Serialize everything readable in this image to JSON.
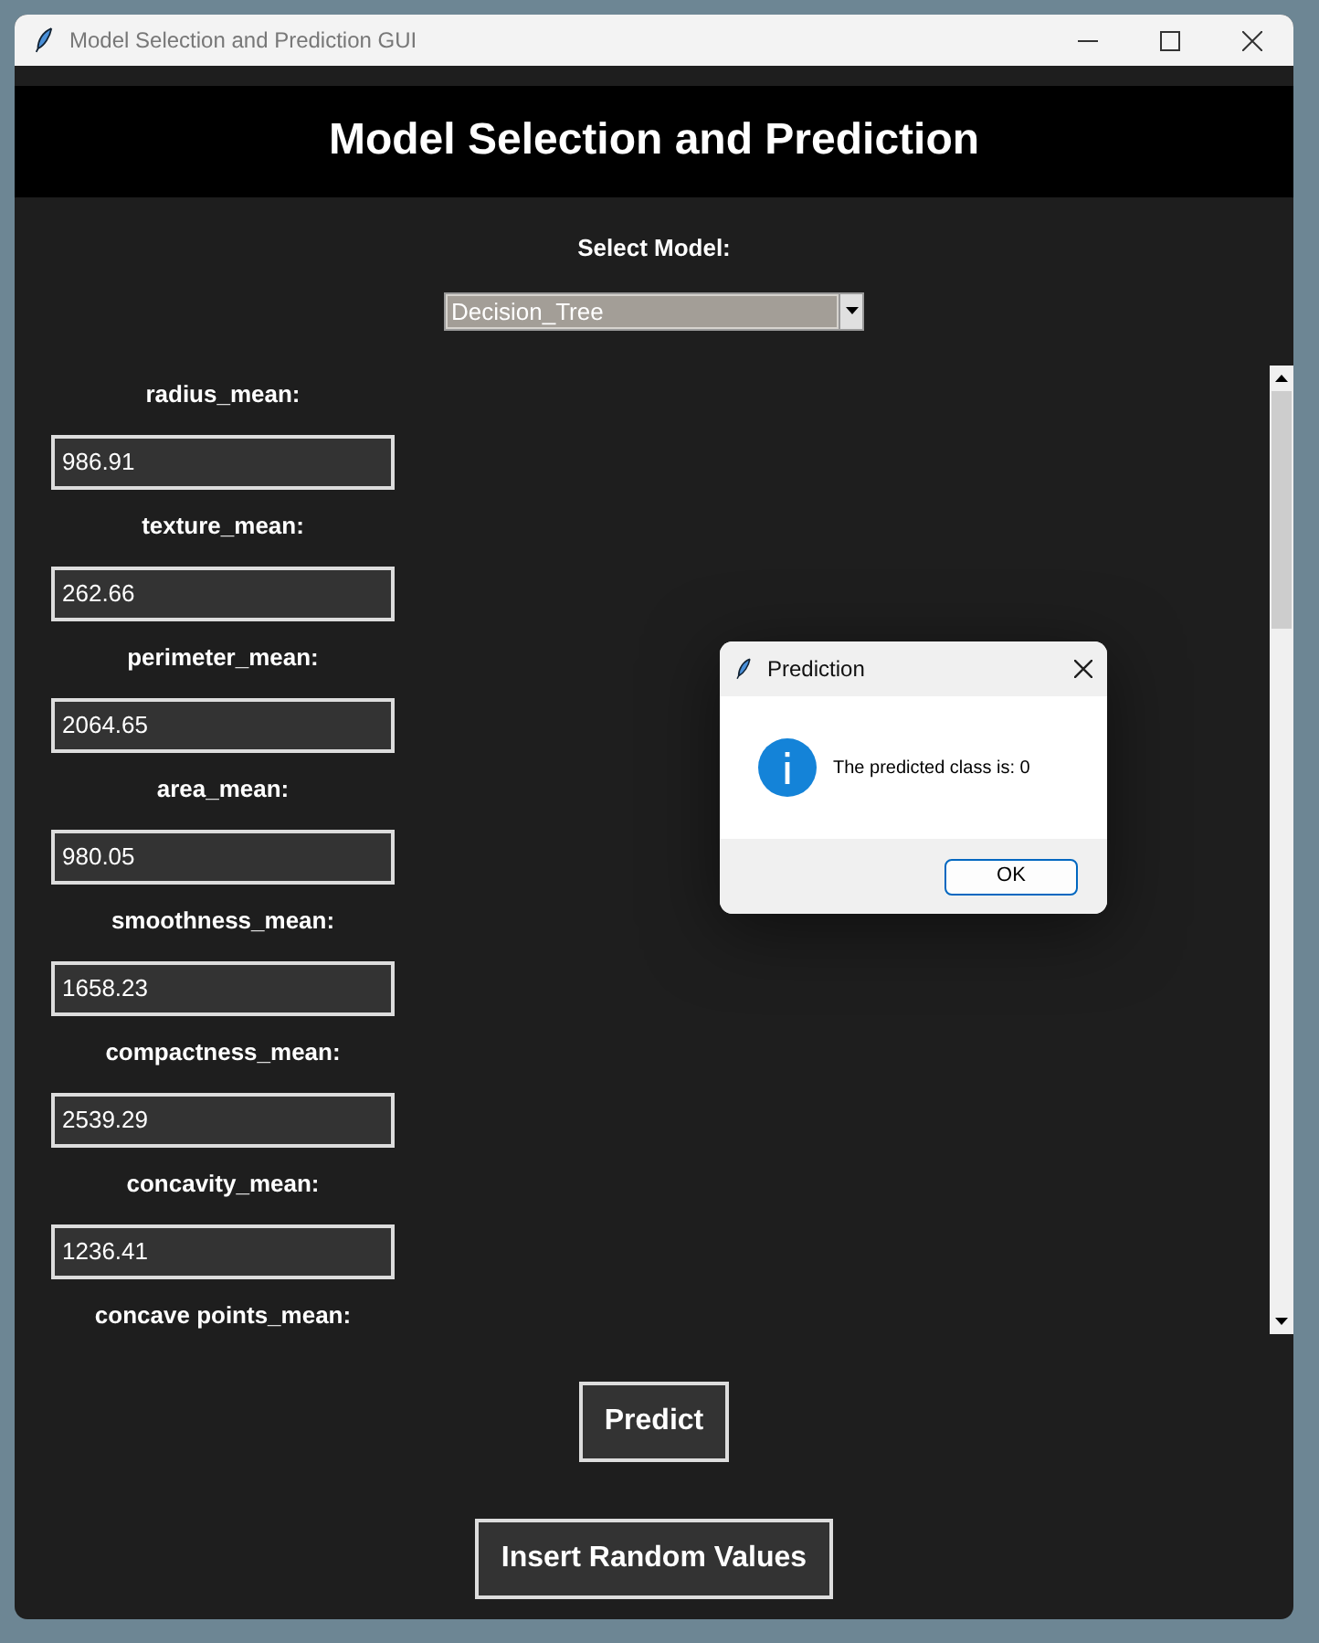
{
  "window": {
    "title": "Model Selection and Prediction GUI"
  },
  "header": {
    "title": "Model Selection and Prediction"
  },
  "model": {
    "label": "Select Model:",
    "value": "Decision_Tree"
  },
  "fields": [
    {
      "label": "radius_mean:",
      "value": "986.91"
    },
    {
      "label": "texture_mean:",
      "value": "262.66"
    },
    {
      "label": "perimeter_mean:",
      "value": "2064.65"
    },
    {
      "label": "area_mean:",
      "value": "980.05"
    },
    {
      "label": "smoothness_mean:",
      "value": "1658.23"
    },
    {
      "label": "compactness_mean:",
      "value": "2539.29"
    },
    {
      "label": "concavity_mean:",
      "value": "1236.41"
    },
    {
      "label": "concave points_mean:"
    }
  ],
  "buttons": [
    "Predict",
    "Insert Random Values"
  ],
  "dialog": {
    "title": "Prediction",
    "message": "The predicted class is: 0",
    "button": "OK"
  }
}
